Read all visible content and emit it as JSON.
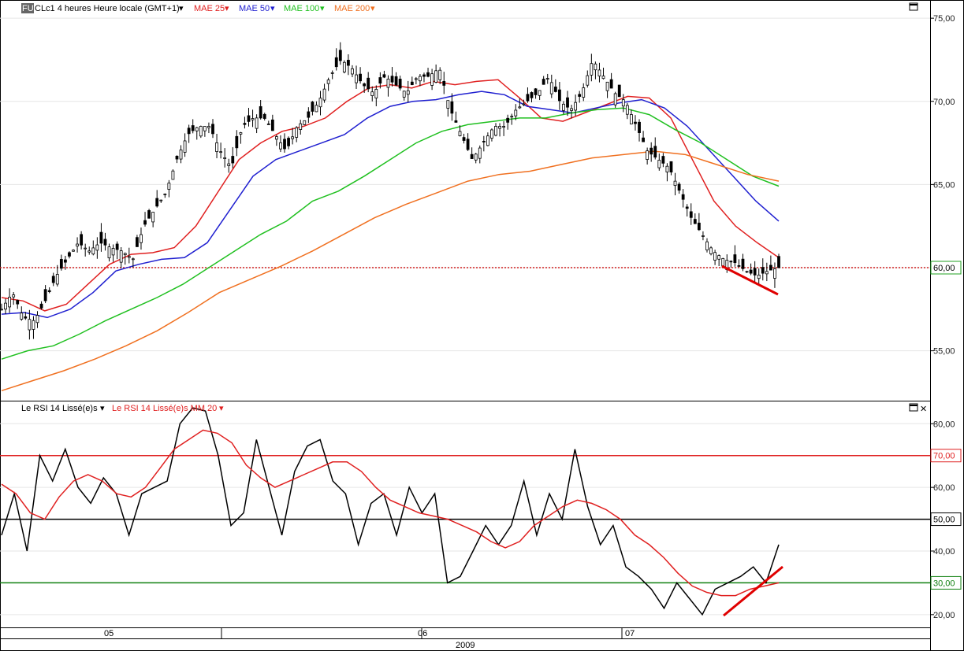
{
  "header": {
    "badge": "FUT",
    "symbol_label": "CLc1 4 heures Heure locale (GMT+1)",
    "indicators": [
      {
        "label": "MAE 25",
        "color": "#e02020"
      },
      {
        "label": "MAE 50",
        "color": "#2020d0"
      },
      {
        "label": "MAE 100",
        "color": "#20c020"
      },
      {
        "label": "MAE 200",
        "color": "#f07020"
      }
    ]
  },
  "rsi_header": {
    "label1": "Le RSI 14 Lissé(e)s",
    "label2": "Le RSI 14 Lissé(e)s MM 20"
  },
  "time_axis": {
    "months": [
      "05",
      "06",
      "07"
    ],
    "year": "2009"
  },
  "chart_data": [
    {
      "type": "candlestick",
      "title": "CLc1 4 heures Heure locale (GMT+1)",
      "ylim": [
        52.0,
        76.0
      ],
      "yticks": [
        "75,00",
        "70,00",
        "65,00",
        "60,00",
        "55,00"
      ],
      "yticks_values": [
        75,
        70,
        65,
        60,
        55
      ],
      "x_categories": [
        "05",
        "06",
        "07"
      ],
      "reference_line": {
        "value": 60.0,
        "label": "60,00",
        "color": "#d02020"
      },
      "series": [
        {
          "name": "MAE 25",
          "color": "#e02020",
          "values": [
            58.2,
            58.0,
            57.4,
            57.8,
            59.0,
            60.2,
            60.8,
            60.9,
            61.2,
            62.5,
            64.5,
            66.5,
            67.5,
            68.2,
            68.5,
            69.0,
            70.0,
            70.8,
            71.0,
            70.8,
            71.2,
            71.0,
            71.2,
            71.3,
            70.2,
            69.0,
            68.8,
            69.3,
            69.8,
            70.3,
            70.2,
            69.0,
            66.5,
            64.0,
            62.5,
            61.5,
            60.6
          ]
        },
        {
          "name": "MAE 50",
          "color": "#2020d0",
          "values": [
            57.2,
            57.3,
            57.0,
            57.5,
            58.5,
            59.8,
            60.2,
            60.5,
            60.6,
            61.5,
            63.5,
            65.5,
            66.5,
            67.0,
            67.5,
            68.0,
            69.0,
            69.7,
            70.0,
            70.1,
            70.4,
            70.6,
            70.4,
            69.7,
            69.5,
            69.3,
            69.6,
            69.9,
            70.1,
            69.6,
            68.5,
            67.0,
            65.5,
            64.0,
            62.8
          ]
        },
        {
          "name": "MAE 100",
          "color": "#20c020",
          "values": [
            54.5,
            55.0,
            55.3,
            56.0,
            56.8,
            57.5,
            58.2,
            59.0,
            60.0,
            61.0,
            62.0,
            62.8,
            64.0,
            64.6,
            65.5,
            66.5,
            67.5,
            68.2,
            68.6,
            68.8,
            69.0,
            69.0,
            69.3,
            69.5,
            69.6,
            69.2,
            68.3,
            67.5,
            66.5,
            65.5,
            64.9
          ]
        },
        {
          "name": "MAE 200",
          "color": "#f07020",
          "values": [
            52.6,
            53.2,
            53.8,
            54.5,
            55.3,
            56.2,
            57.3,
            58.5,
            59.3,
            60.1,
            61.0,
            62.0,
            63.0,
            63.8,
            64.5,
            65.2,
            65.6,
            65.8,
            66.2,
            66.6,
            66.8,
            67.0,
            66.8,
            66.2,
            65.6,
            65.2
          ]
        },
        {
          "name": "Close",
          "color": "#000000",
          "values": [
            57.5,
            58.5,
            57.0,
            56.8,
            58.0,
            59.5,
            60.5,
            61.5,
            61.0,
            61.5,
            61.2,
            61.0,
            60.5,
            62.5,
            63.5,
            64.5,
            66.5,
            68.0,
            68.5,
            68.5,
            67.0,
            66.0,
            68.5,
            69.0,
            69.0,
            68.0,
            67.0,
            68.5,
            69.0,
            70.0,
            71.5,
            72.5,
            72.0,
            71.0,
            70.5,
            71.5,
            71.0,
            70.5,
            71.5,
            71.5,
            72.0,
            69.5,
            68.0,
            66.5,
            67.5,
            68.5,
            68.5,
            69.5,
            70.0,
            70.5,
            71.5,
            70.0,
            69.5,
            70.5,
            72.5,
            71.5,
            70.5,
            70.0,
            68.5,
            67.0,
            66.5,
            66.0,
            64.5,
            63.0,
            62.0,
            61.0,
            60.5,
            60.3,
            59.8,
            59.5,
            59.8,
            60.0
          ]
        }
      ]
    },
    {
      "type": "line",
      "title": "Le RSI 14 Lissé(e)s",
      "ylim": [
        16.0,
        87.0
      ],
      "yticks": [
        "80,00",
        "70,00",
        "60,00",
        "50,00",
        "40,00",
        "30,00",
        "20,00"
      ],
      "yticks_values": [
        80,
        70,
        60,
        50,
        40,
        30,
        20
      ],
      "x_categories": [
        "05",
        "06",
        "07"
      ],
      "reference_lines": [
        {
          "value": 70,
          "label": "70,00",
          "color": "#e02020"
        },
        {
          "value": 50,
          "label": "50,00",
          "color": "#000000"
        },
        {
          "value": 30,
          "label": "30,00",
          "color": "#108010"
        }
      ],
      "series": [
        {
          "name": "Le RSI 14 Lissé(e)s",
          "color": "#000000",
          "values": [
            45,
            58,
            40,
            70,
            62,
            72,
            60,
            55,
            63,
            58,
            45,
            58,
            60,
            62,
            80,
            85,
            84,
            70,
            48,
            52,
            75,
            60,
            45,
            65,
            73,
            75,
            62,
            58,
            42,
            55,
            58,
            45,
            60,
            52,
            58,
            30,
            32,
            40,
            48,
            42,
            48,
            62,
            45,
            58,
            50,
            72,
            54,
            42,
            48,
            35,
            32,
            28,
            22,
            30,
            25,
            20,
            28,
            30,
            32,
            35,
            30,
            42
          ]
        },
        {
          "name": "Le RSI 14 Lissé(e)s MM 20",
          "color": "#e02020",
          "values": [
            61,
            58,
            52,
            50,
            57,
            62,
            64,
            62,
            58,
            57,
            60,
            66,
            72,
            75,
            78,
            77,
            74,
            67,
            63,
            60,
            62,
            64,
            66,
            68,
            68,
            65,
            60,
            56,
            54,
            52,
            51,
            50,
            48,
            46,
            43,
            41,
            43,
            48,
            51,
            54,
            56,
            55,
            53,
            50,
            45,
            42,
            38,
            33,
            29,
            27,
            26,
            26,
            28,
            29,
            30
          ]
        }
      ]
    }
  ],
  "colors": {
    "border": "#000000",
    "axis_text": "#202020",
    "gridline": "#e6e6e6",
    "bull_candle": "#ffffff",
    "bear_candle": "#000000",
    "trend_red": "#e00000",
    "price_tag": "#20a020"
  }
}
